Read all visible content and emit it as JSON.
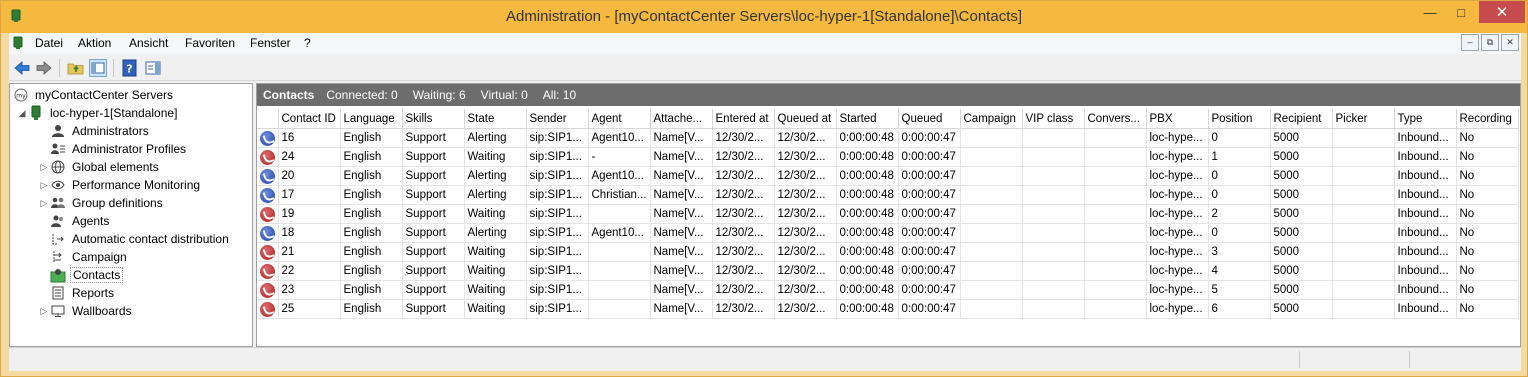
{
  "window": {
    "title": "Administration - [myContactCenter Servers\\loc-hyper-1[Standalone]\\Contacts]",
    "minimize": "—",
    "maximize": "□",
    "close": "✕"
  },
  "menu": {
    "items": [
      "Datei",
      "Aktion",
      "Ansicht",
      "Favoriten",
      "Fenster",
      "?"
    ],
    "mdi": {
      "minimize": "–",
      "restore": "⧉",
      "close": "✕"
    }
  },
  "toolbar": {
    "buttons": [
      "back-arrow-icon",
      "forward-arrow-icon",
      "up-folder-icon",
      "show-hide-tree-icon",
      "help-icon",
      "action-pane-icon"
    ]
  },
  "tree": {
    "root": "myContactCenter Servers",
    "server": "loc-hyper-1[Standalone]",
    "items": [
      {
        "label": "Administrators",
        "icon": "person-icon",
        "expandable": false
      },
      {
        "label": "Administrator Profiles",
        "icon": "profile-icon",
        "expandable": false
      },
      {
        "label": "Global elements",
        "icon": "globe-icon",
        "expandable": true
      },
      {
        "label": "Performance Monitoring",
        "icon": "eye-icon",
        "expandable": true
      },
      {
        "label": "Group definitions",
        "icon": "group-icon",
        "expandable": true
      },
      {
        "label": "Agents",
        "icon": "agents-icon",
        "expandable": false
      },
      {
        "label": "Automatic contact distribution",
        "icon": "distribution-icon",
        "expandable": false
      },
      {
        "label": "Campaign",
        "icon": "campaign-icon",
        "expandable": false
      },
      {
        "label": "Contacts",
        "icon": "contacts-icon",
        "expandable": false
      },
      {
        "label": "Reports",
        "icon": "reports-icon",
        "expandable": false
      },
      {
        "label": "Wallboards",
        "icon": "monitor-icon",
        "expandable": true
      }
    ],
    "selected": "Contacts"
  },
  "contacts": {
    "title": "Contacts",
    "connected": "Connected: 0",
    "waiting": "Waiting: 6",
    "virtual": "Virtual: 0",
    "all": "All: 10"
  },
  "table": {
    "columns": [
      "",
      "Contact ID",
      "Language",
      "Skills",
      "State",
      "Sender",
      "Agent",
      "Attache...",
      "Entered at",
      "Queued at",
      "Started",
      "Queued",
      "Campaign",
      "VIP class",
      "Convers...",
      "PBX",
      "Position",
      "Recipient",
      "Picker",
      "Type",
      "Recording"
    ],
    "rows": [
      {
        "icon": "blue",
        "cells": [
          "16",
          "English",
          "Support",
          "Alerting",
          "sip:SIP1...",
          "Agent10...",
          "Name[V...",
          "12/30/2...",
          "12/30/2...",
          "0:00:00:48",
          "0:00:00:47",
          "",
          "",
          "",
          "loc-hype...",
          "0",
          "5000",
          "",
          "Inbound...",
          "No"
        ]
      },
      {
        "icon": "red",
        "cells": [
          "24",
          "English",
          "Support",
          "Waiting",
          "sip:SIP1...",
          "-",
          "Name[V...",
          "12/30/2...",
          "12/30/2...",
          "0:00:00:48",
          "0:00:00:47",
          "",
          "",
          "",
          "loc-hype...",
          "1",
          "5000",
          "",
          "Inbound...",
          "No"
        ]
      },
      {
        "icon": "blue",
        "cells": [
          "20",
          "English",
          "Support",
          "Alerting",
          "sip:SIP1...",
          "Agent10...",
          "Name[V...",
          "12/30/2...",
          "12/30/2...",
          "0:00:00:48",
          "0:00:00:47",
          "",
          "",
          "",
          "loc-hype...",
          "0",
          "5000",
          "",
          "Inbound...",
          "No"
        ]
      },
      {
        "icon": "blue",
        "cells": [
          "17",
          "English",
          "Support",
          "Alerting",
          "sip:SIP1...",
          "Christian...",
          "Name[V...",
          "12/30/2...",
          "12/30/2...",
          "0:00:00:48",
          "0:00:00:47",
          "",
          "",
          "",
          "loc-hype...",
          "0",
          "5000",
          "",
          "Inbound...",
          "No"
        ]
      },
      {
        "icon": "red",
        "cells": [
          "19",
          "English",
          "Support",
          "Waiting",
          "sip:SIP1...",
          "",
          "Name[V...",
          "12/30/2...",
          "12/30/2...",
          "0:00:00:48",
          "0:00:00:47",
          "",
          "",
          "",
          "loc-hype...",
          "2",
          "5000",
          "",
          "Inbound...",
          "No"
        ]
      },
      {
        "icon": "blue",
        "cells": [
          "18",
          "English",
          "Support",
          "Alerting",
          "sip:SIP1...",
          "Agent10...",
          "Name[V...",
          "12/30/2...",
          "12/30/2...",
          "0:00:00:48",
          "0:00:00:47",
          "",
          "",
          "",
          "loc-hype...",
          "0",
          "5000",
          "",
          "Inbound...",
          "No"
        ]
      },
      {
        "icon": "red",
        "cells": [
          "21",
          "English",
          "Support",
          "Waiting",
          "sip:SIP1...",
          "",
          "Name[V...",
          "12/30/2...",
          "12/30/2...",
          "0:00:00:48",
          "0:00:00:47",
          "",
          "",
          "",
          "loc-hype...",
          "3",
          "5000",
          "",
          "Inbound...",
          "No"
        ]
      },
      {
        "icon": "red",
        "cells": [
          "22",
          "English",
          "Support",
          "Waiting",
          "sip:SIP1...",
          "",
          "Name[V...",
          "12/30/2...",
          "12/30/2...",
          "0:00:00:48",
          "0:00:00:47",
          "",
          "",
          "",
          "loc-hype...",
          "4",
          "5000",
          "",
          "Inbound...",
          "No"
        ]
      },
      {
        "icon": "red",
        "cells": [
          "23",
          "English",
          "Support",
          "Waiting",
          "sip:SIP1...",
          "",
          "Name[V...",
          "12/30/2...",
          "12/30/2...",
          "0:00:00:48",
          "0:00:00:47",
          "",
          "",
          "",
          "loc-hype...",
          "5",
          "5000",
          "",
          "Inbound...",
          "No"
        ]
      },
      {
        "icon": "red",
        "cells": [
          "25",
          "English",
          "Support",
          "Waiting",
          "sip:SIP1...",
          "",
          "Name[V...",
          "12/30/2...",
          "12/30/2...",
          "0:00:00:48",
          "0:00:00:47",
          "",
          "",
          "",
          "loc-hype...",
          "6",
          "5000",
          "",
          "Inbound...",
          "No"
        ]
      }
    ]
  },
  "colors": {
    "titlebar": "#f5b940",
    "header_bar": "#6d6d6d",
    "phone_blue": "#1b3fa8",
    "phone_red": "#a81b1b"
  }
}
